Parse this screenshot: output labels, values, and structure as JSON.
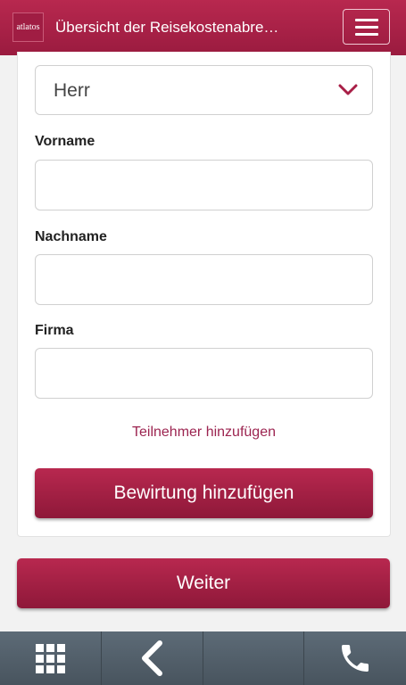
{
  "header": {
    "logo_text": "atlatos",
    "title": "Übersicht der Reisekostenabre…"
  },
  "form": {
    "salutation_value": "Herr",
    "firstname_label": "Vorname",
    "firstname_value": "",
    "lastname_label": "Nachname",
    "lastname_value": "",
    "company_label": "Firma",
    "company_value": "",
    "add_participant_link": "Teilnehmer hinzufügen",
    "add_hospitality_button": "Bewirtung hinzufügen"
  },
  "actions": {
    "next_button": "Weiter"
  },
  "footer": {
    "items": [
      "apps-grid-icon",
      "back-chevron-icon",
      "empty",
      "phone-icon"
    ]
  },
  "colors": {
    "brand": "#a81f47",
    "footer_bg": "#55626d"
  }
}
